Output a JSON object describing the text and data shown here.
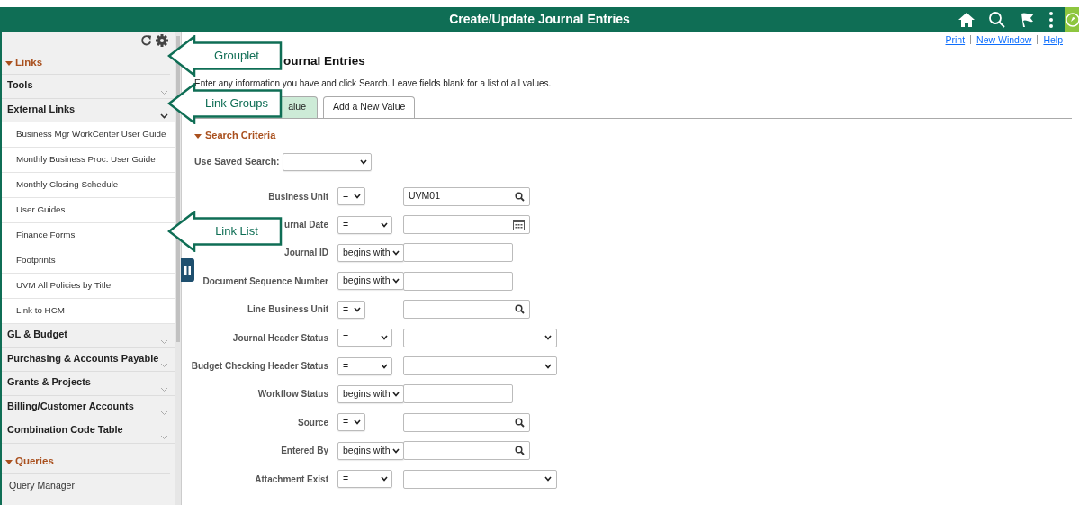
{
  "header": {
    "title": "Create/Update Journal Entries"
  },
  "top_links": [
    "Print",
    "New Window",
    "Help"
  ],
  "sidebar": {
    "sections": [
      {
        "title": "Links",
        "expanded": true,
        "groups": [
          {
            "label": "Tools",
            "expanded": false
          },
          {
            "label": "External Links",
            "expanded": true,
            "links": [
              "Business Mgr WorkCenter User Guide",
              "Monthly Business Proc. User Guide",
              "Monthly Closing Schedule",
              "User Guides",
              "Finance Forms",
              "Footprints",
              "UVM All Policies by Title",
              "Link to HCM"
            ]
          },
          {
            "label": "GL & Budget",
            "expanded": false
          },
          {
            "label": "Purchasing & Accounts Payable",
            "expanded": false
          },
          {
            "label": "Grants & Projects",
            "expanded": false
          },
          {
            "label": "Billing/Customer Accounts",
            "expanded": false
          },
          {
            "label": "Combination Code Table",
            "expanded": false
          }
        ]
      },
      {
        "title": "Queries",
        "expanded": true,
        "links": [
          "Query Manager"
        ]
      }
    ]
  },
  "page": {
    "heading": "ournal Entries",
    "instructions": "Enter any information you have and click Search. Leave fields blank for a list of all values.",
    "tabs": [
      {
        "label": "alue",
        "selected": true
      },
      {
        "label": "Add a New Value",
        "selected": false
      }
    ],
    "search_criteria": {
      "title": "Search Criteria",
      "expanded": true,
      "saved_search_label": "Use Saved Search:",
      "fields": [
        {
          "label": "Business Unit",
          "operator": "=",
          "kind": "lookup",
          "value": "UVM01"
        },
        {
          "label": "urnal Date",
          "operator": "=",
          "kind": "date"
        },
        {
          "label": "Journal ID",
          "operator": "begins with",
          "kind": "text"
        },
        {
          "label": "Document Sequence Number",
          "operator": "begins with",
          "kind": "text"
        },
        {
          "label": "Line Business Unit",
          "operator": "=",
          "kind": "lookup"
        },
        {
          "label": "Journal Header Status",
          "operator": "=",
          "kind": "dropdown"
        },
        {
          "label": "Budget Checking Header Status",
          "operator": "=",
          "kind": "dropdown"
        },
        {
          "label": "Workflow Status",
          "operator": "begins with",
          "kind": "text"
        },
        {
          "label": "Source",
          "operator": "=",
          "kind": "lookup"
        },
        {
          "label": "Entered By",
          "operator": "begins with",
          "kind": "lookup"
        },
        {
          "label": "Attachment Exist",
          "operator": "=",
          "kind": "dropdown"
        }
      ]
    }
  },
  "callouts": [
    {
      "label": "Grouplet"
    },
    {
      "label": "Link Groups"
    },
    {
      "label": "Link List"
    }
  ]
}
